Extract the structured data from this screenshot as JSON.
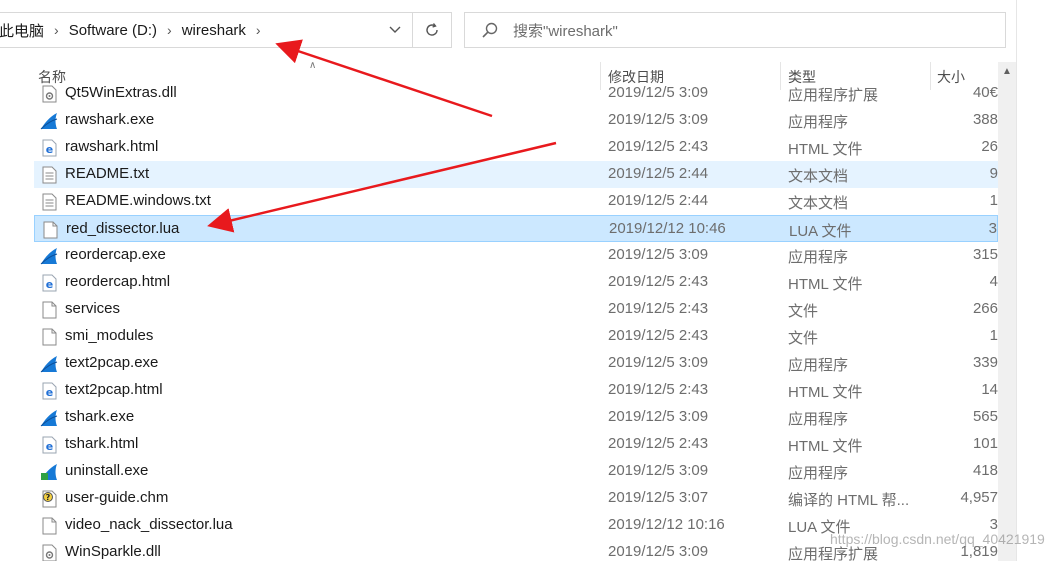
{
  "address": {
    "crumbs": [
      "此电脑",
      "Software (D:)",
      "wireshark"
    ],
    "separator": ">"
  },
  "search": {
    "placeholder": "搜索\"wireshark\""
  },
  "columns": {
    "name": "名称",
    "date": "修改日期",
    "type": "类型",
    "size": "大小"
  },
  "files": [
    {
      "name": "Qt5WinExtras.dll",
      "date": "2019/12/5 3:09",
      "type": "应用程序扩展",
      "size": "40€",
      "icon": "dll-icon"
    },
    {
      "name": "rawshark.exe",
      "date": "2019/12/5 3:09",
      "type": "应用程序",
      "size": "388",
      "icon": "wireshark-fin-icon"
    },
    {
      "name": "rawshark.html",
      "date": "2019/12/5 2:43",
      "type": "HTML 文件",
      "size": "26",
      "icon": "edge-html-icon"
    },
    {
      "name": "README.txt",
      "date": "2019/12/5 2:44",
      "type": "文本文档",
      "size": "9",
      "icon": "text-file-icon",
      "state": "hover"
    },
    {
      "name": "README.windows.txt",
      "date": "2019/12/5 2:44",
      "type": "文本文档",
      "size": "1",
      "icon": "text-file-icon"
    },
    {
      "name": "red_dissector.lua",
      "date": "2019/12/12 10:46",
      "type": "LUA 文件",
      "size": "3",
      "icon": "blank-file-icon",
      "state": "selected"
    },
    {
      "name": "reordercap.exe",
      "date": "2019/12/5 3:09",
      "type": "应用程序",
      "size": "315",
      "icon": "wireshark-fin-icon"
    },
    {
      "name": "reordercap.html",
      "date": "2019/12/5 2:43",
      "type": "HTML 文件",
      "size": "4",
      "icon": "edge-html-icon"
    },
    {
      "name": "services",
      "date": "2019/12/5 2:43",
      "type": "文件",
      "size": "266",
      "icon": "blank-file-icon"
    },
    {
      "name": "smi_modules",
      "date": "2019/12/5 2:43",
      "type": "文件",
      "size": "1",
      "icon": "blank-file-icon"
    },
    {
      "name": "text2pcap.exe",
      "date": "2019/12/5 3:09",
      "type": "应用程序",
      "size": "339",
      "icon": "wireshark-fin-icon"
    },
    {
      "name": "text2pcap.html",
      "date": "2019/12/5 2:43",
      "type": "HTML 文件",
      "size": "14",
      "icon": "edge-html-icon"
    },
    {
      "name": "tshark.exe",
      "date": "2019/12/5 3:09",
      "type": "应用程序",
      "size": "565",
      "icon": "wireshark-fin-icon"
    },
    {
      "name": "tshark.html",
      "date": "2019/12/5 2:43",
      "type": "HTML 文件",
      "size": "101",
      "icon": "edge-html-icon"
    },
    {
      "name": "uninstall.exe",
      "date": "2019/12/5 3:09",
      "type": "应用程序",
      "size": "418",
      "icon": "uninstall-icon"
    },
    {
      "name": "user-guide.chm",
      "date": "2019/12/5 3:07",
      "type": "编译的 HTML 帮...",
      "size": "4,957",
      "icon": "chm-help-icon"
    },
    {
      "name": "video_nack_dissector.lua",
      "date": "2019/12/12 10:16",
      "type": "LUA 文件",
      "size": "3",
      "icon": "blank-file-icon"
    },
    {
      "name": "WinSparkle.dll",
      "date": "2019/12/5 3:09",
      "type": "应用程序扩展",
      "size": "1,819",
      "icon": "dll-icon"
    }
  ],
  "watermark": "https://blog.csdn.net/qq_40421919",
  "colors": {
    "hover": "#e5f3ff",
    "selected": "#cce8ff",
    "selected_border": "#99d1ff",
    "annotation_arrow": "#e8191d",
    "wireshark_blue": "#1679d6"
  }
}
